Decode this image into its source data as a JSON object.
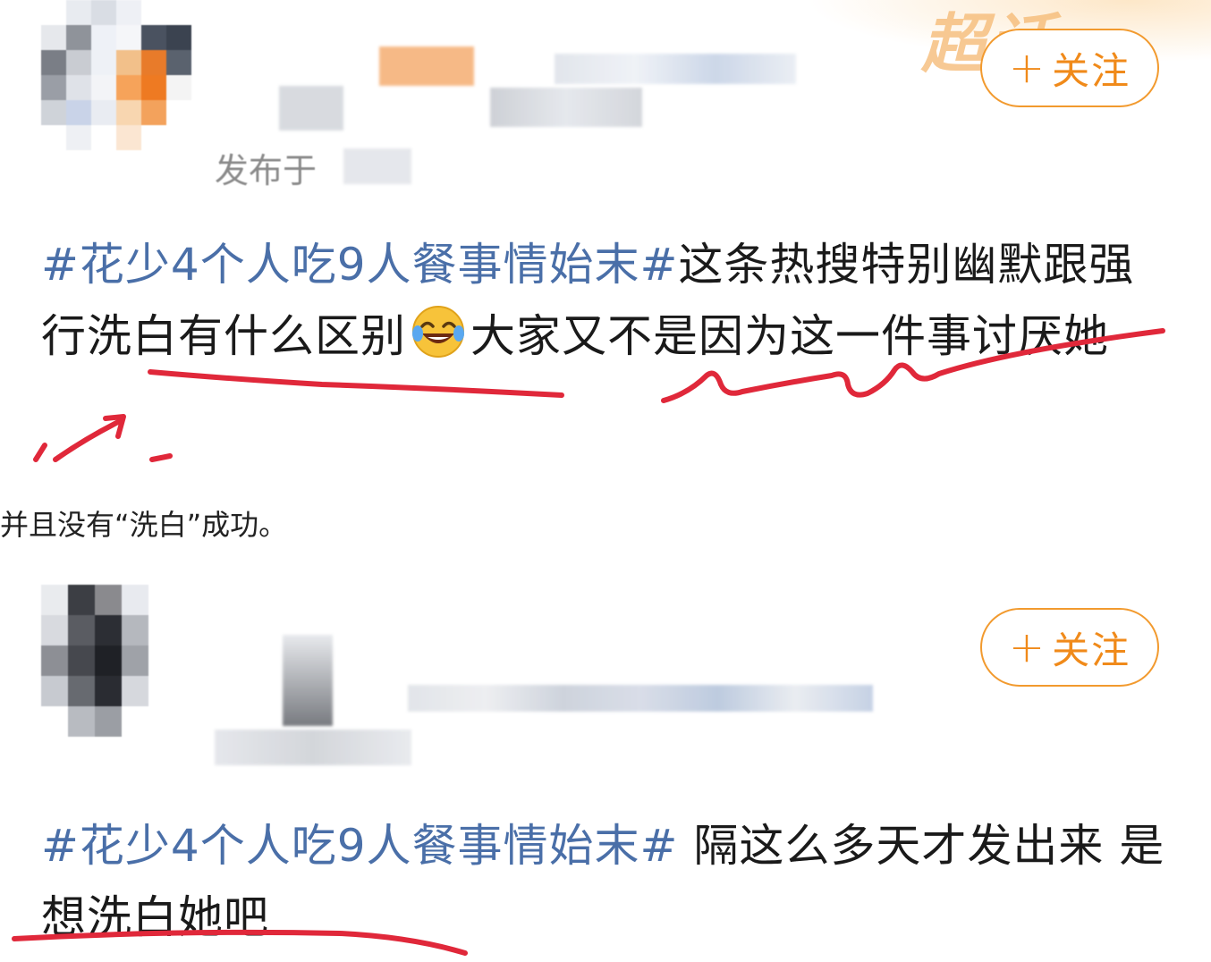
{
  "card1": {
    "supertopic_badge": "超话",
    "follow_label": "关注",
    "follow_plus": "+",
    "published_prefix": "发布于",
    "post": {
      "hashtag": "#花少4个人吃9人餐事情始末#",
      "text_part1": "这条热搜特别幽默跟强行洗白有什么区别",
      "emoji": "laughing-crying-emoji",
      "text_part2": "大家又不是因为这一件事讨厌她"
    }
  },
  "caption": "并且没有“洗白”成功。",
  "card2": {
    "follow_label": "关注",
    "follow_plus": "+",
    "post": {
      "hashtag": "#花少4个人吃9人餐事情始末#",
      "text": " 隔这么多天才发出来 是想洗白她吧"
    }
  },
  "colors": {
    "hashtag": "#4a6fa8",
    "follow": "#f08a1a",
    "annotation": "#e0283a"
  }
}
